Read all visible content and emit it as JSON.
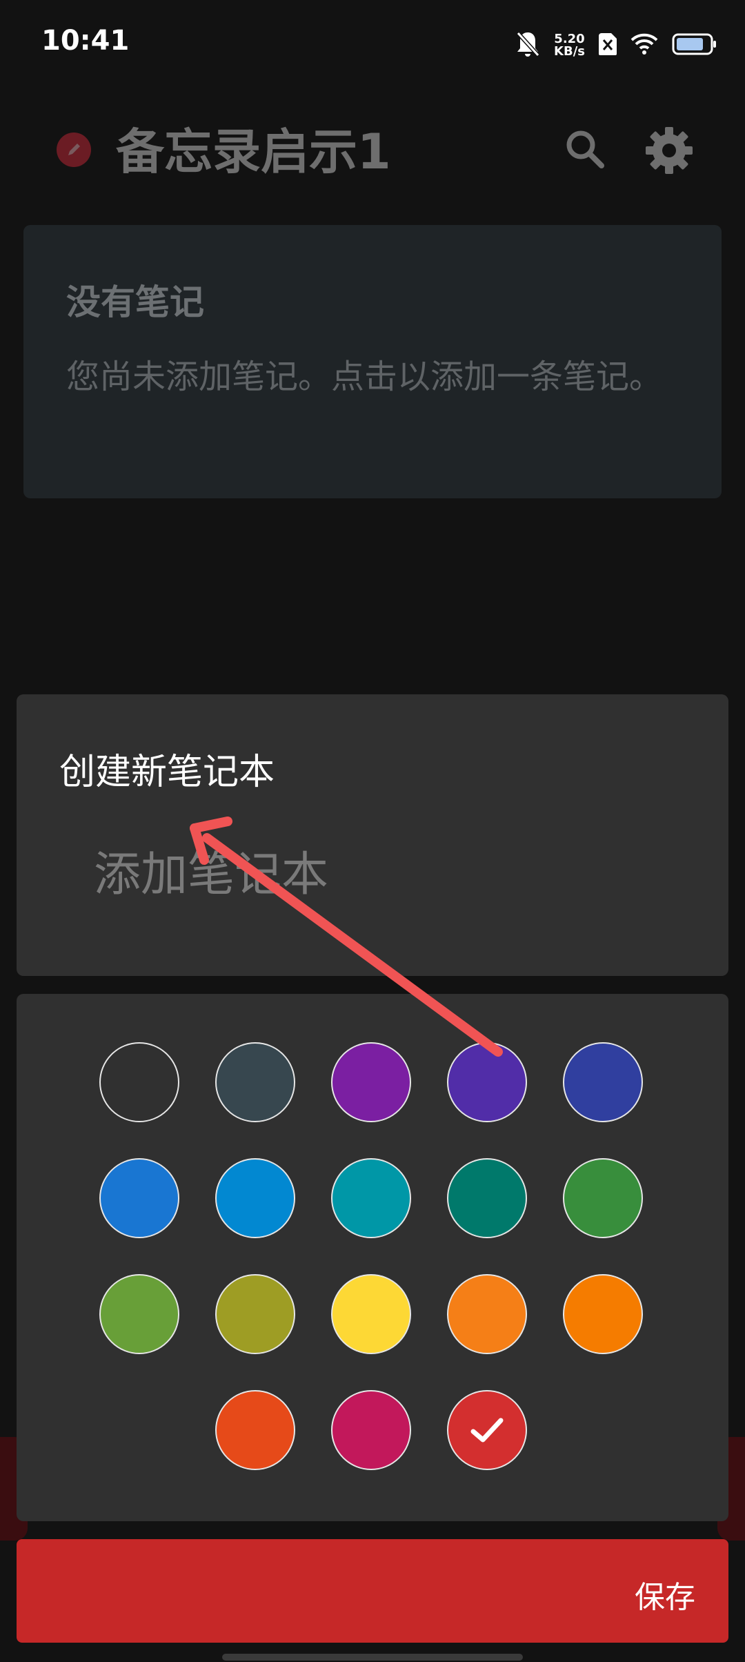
{
  "status_bar": {
    "time": "10:41",
    "net_speed_value": "5.20",
    "net_speed_unit": "KB/s"
  },
  "app_bar": {
    "title": "备忘录启示1"
  },
  "empty_card": {
    "title": "没有笔记",
    "description": "您尚未添加笔记。点击以添加一条笔记。"
  },
  "dialog": {
    "title": "创建新笔记本",
    "input_placeholder": "添加笔记本",
    "input_value": ""
  },
  "color_picker": {
    "selected_index": 17,
    "swatches": [
      "#303030",
      "#37474f",
      "#7b1fa2",
      "#512da8",
      "#303f9f",
      "#1976d2",
      "#0288d1",
      "#0097a7",
      "#00796b",
      "#388e3c",
      "#689f38",
      "#9e9d24",
      "#fdd835",
      "#f57f17",
      "#f57c00",
      "#e64a19",
      "#c2185b",
      "#d32f2f"
    ]
  },
  "save_bar": {
    "label": "保存"
  },
  "colors": {
    "accent": "#c62828",
    "annotation_arrow": "#f05454"
  }
}
